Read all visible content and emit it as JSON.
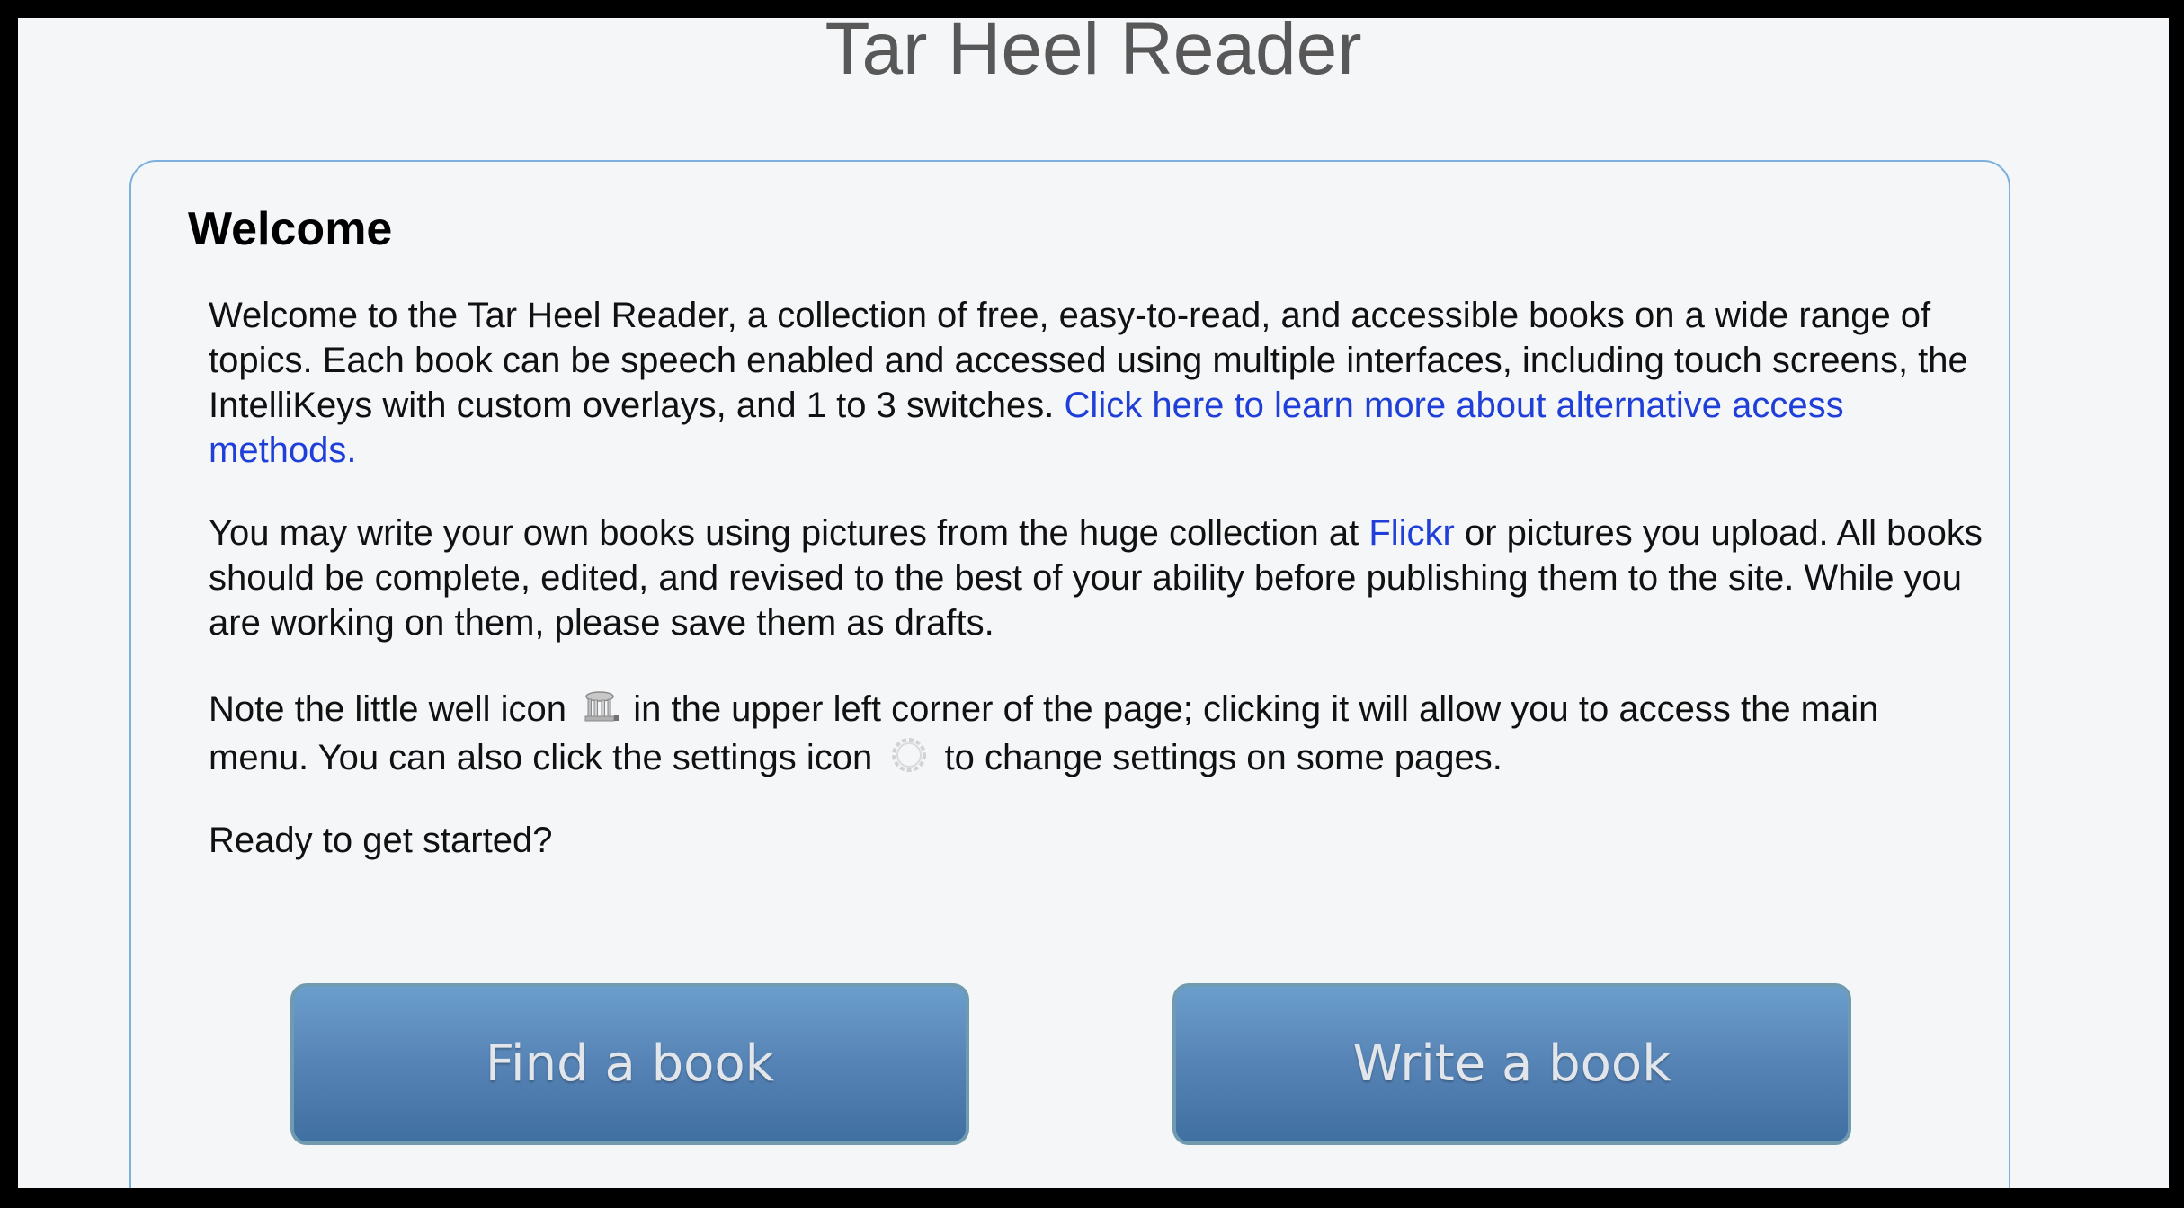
{
  "header": {
    "title": "Tar Heel Reader"
  },
  "welcome": {
    "heading": "Welcome",
    "paragraph1": {
      "text": "Welcome to the Tar Heel Reader, a collection of free, easy-to-read, and accessible books on a wide range of topics. Each book can be speech enabled and accessed using multiple interfaces, including touch screens, the IntelliKeys with custom overlays, and 1 to 3 switches.",
      "link_text": "Click here to learn more about alternative access methods."
    },
    "paragraph2": {
      "text_before_link": "You may write your own books using pictures from the huge collection at",
      "link_text": "Flickr",
      "text_after_link": "or pictures you upload. All books should be complete, edited, and revised to the best of your ability before publishing them to the site. While you are working on them, please save them as drafts."
    },
    "paragraph3": {
      "text_before_well_icon": "Note the little well icon",
      "text_after_well_icon": "in the upper left corner of the page; clicking it will allow you to access the main menu. You can also click the settings icon",
      "text_after_settings_icon": "to change settings on some pages."
    },
    "ready_text": "Ready to get started?"
  },
  "actions": {
    "find_label": "Find a book",
    "write_label": "Write a book"
  },
  "icons": {
    "well": "old-well-icon",
    "settings": "gear-icon"
  },
  "colors": {
    "link": "#1f3fd8",
    "panel_border": "#7eb0dd",
    "button_top": "#6b9ecc",
    "button_bottom": "#406fa2",
    "button_text": "#e2e6ea",
    "page_background": "#f4f6f8"
  }
}
